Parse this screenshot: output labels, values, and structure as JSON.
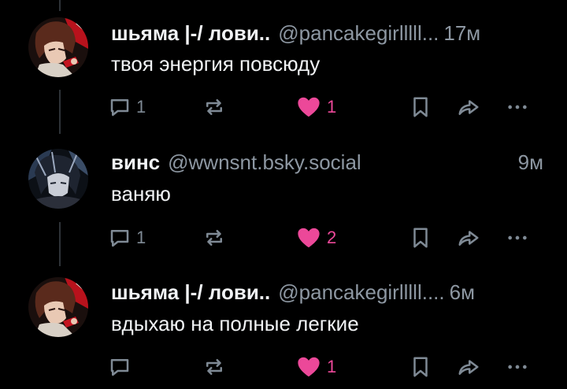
{
  "colors": {
    "background": "#000000",
    "text": "#f1f3f5",
    "muted": "#8d97a2",
    "icon": "#7f8a95",
    "like": "#ec4899",
    "thread_line": "#2e3338"
  },
  "posts": [
    {
      "display_name": "шьяма |-/ лови..",
      "handle": "@pancakegirlllll...",
      "time": "17м",
      "text": "твоя энергия повсюду",
      "reply_count": "1",
      "like_count": "1",
      "liked": true,
      "avatar": "red-haired-anime-avatar"
    },
    {
      "display_name": "винс",
      "handle": "@wwnsnt.bsky.social",
      "time": "9м",
      "text": "ваняю",
      "reply_count": "1",
      "like_count": "2",
      "liked": true,
      "avatar": "dark-haired-anime-avatar"
    },
    {
      "display_name": "шьяма |-/ лови..",
      "handle": "@pancakegirlllll....",
      "time": "6м",
      "text": "вдыхаю на полные легкие",
      "reply_count": "",
      "like_count": "1",
      "liked": true,
      "avatar": "red-haired-anime-avatar"
    }
  ],
  "icons": {
    "reply": "reply-bubble-icon",
    "repost": "repost-arrows-icon",
    "like": "heart-icon",
    "bookmark": "bookmark-icon",
    "share": "share-arrow-icon",
    "more": "more-dots-icon"
  }
}
